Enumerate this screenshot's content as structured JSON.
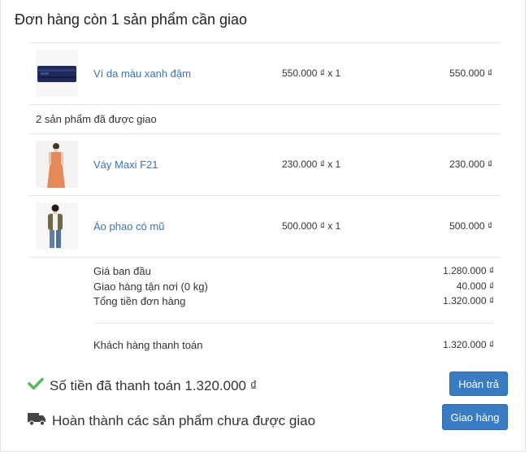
{
  "header": {
    "title": "Đơn hàng còn 1 sản phẩm cần giao"
  },
  "pending_items": [
    {
      "name": "Ví da màu xanh đậm",
      "qty": "550.000 ₫ x 1",
      "total": "550.000 ₫",
      "image": "wallet-thumbnail"
    }
  ],
  "delivered_header": "2 sản phẩm đã được giao",
  "delivered_items": [
    {
      "name": "Váy Maxi F21",
      "qty": "230.000 ₫ x 1",
      "total": "230.000 ₫",
      "image": "dress-thumbnail"
    },
    {
      "name": "Áo phao có mũ",
      "qty": "500.000 ₫ x 1",
      "total": "500.000 ₫",
      "image": "jacket-thumbnail"
    }
  ],
  "summary": {
    "subtotal_label": "Giá ban đầu",
    "subtotal_value": "1.280.000 ₫",
    "shipping_label": "Giao hàng tận nơi (0 kg)",
    "shipping_value": "40.000 ₫",
    "total_label": "Tổng tiền đơn hàng",
    "total_value": "1.320.000 ₫",
    "paid_label": "Khách hàng thanh toán",
    "paid_value": "1.320.000 ₫"
  },
  "payment_status": {
    "text": "Số tiền đã thanh toán 1.320.000 ₫",
    "icon": "check-icon",
    "icon_color": "#5cb85c"
  },
  "fulfillment_status": {
    "text": "Hoàn thành các sản phẩm chưa được giao",
    "icon": "truck-icon"
  },
  "buttons": {
    "refund": "Hoàn trả",
    "fulfill": "Giao hàng"
  },
  "colors": {
    "link": "#3b73b0",
    "button": "#3a7cc4"
  }
}
